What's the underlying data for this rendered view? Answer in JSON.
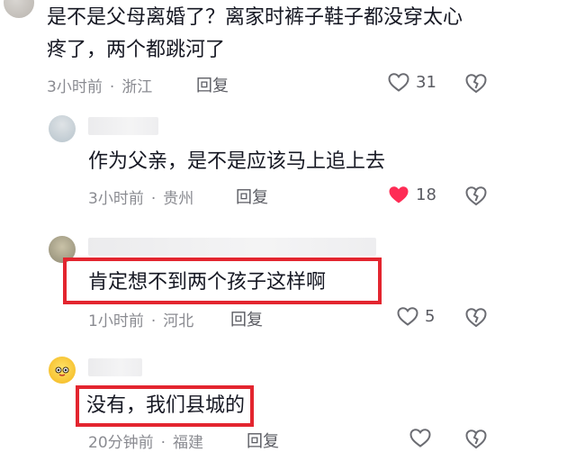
{
  "comments": [
    {
      "text_line1": "是不是父母离婚了？离家时裤子鞋子都没穿太心",
      "text_line2": "疼了，两个都跳河了",
      "time": "3小时前",
      "location": "浙江",
      "reply_label": "回复",
      "likes": "31",
      "liked": false
    },
    {
      "text": "作为父亲，是不是应该马上追上去",
      "time": "3小时前",
      "location": "贵州",
      "reply_label": "回复",
      "likes": "18",
      "liked": true
    },
    {
      "text": "肯定想不到两个孩子这样啊",
      "time": "1小时前",
      "location": "河北",
      "reply_label": "回复",
      "likes": "5",
      "liked": false,
      "highlighted": true
    },
    {
      "text": "没有，我们县城的",
      "time": "20分钟前",
      "location": "福建",
      "reply_label": "回复",
      "likes": "",
      "liked": false,
      "highlighted": true
    }
  ],
  "colors": {
    "liked_heart": "#fe2c55",
    "highlight_border": "#e3252f",
    "meta_text": "#8a8b91"
  },
  "icons": {
    "like": "heart-outline-icon",
    "liked": "heart-filled-icon",
    "dislike": "broken-heart-icon"
  }
}
